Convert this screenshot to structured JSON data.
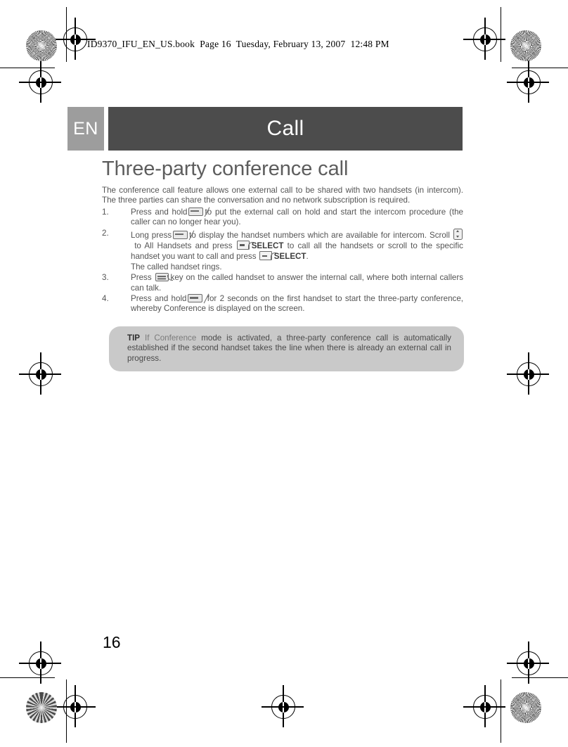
{
  "print_header": {
    "text": "ID9370_IFU_EN_US.book  Page 16  Tuesday, February 13, 2007  12:48 PM"
  },
  "language_tab": {
    "label": "EN"
  },
  "chapter": {
    "title": "Call"
  },
  "section": {
    "title": "Three-party conference call"
  },
  "intro": {
    "text": "The conference call feature allows one external call to be shared with two handsets (in intercom). The three parties can share the conversation and no network subscription is required."
  },
  "steps": [
    {
      "number": "1.",
      "part1": "Press and hold",
      "icon1": "intercom-key-icon",
      "part2": "to put the external call on hold and start the intercom procedure (the caller can no longer hear you)."
    },
    {
      "number": "2.",
      "part1": "Long press",
      "icon1": "intercom-key-icon",
      "part2": "to display the handset numbers which are available for intercom. Scroll",
      "icon2": "scroll-key-icon",
      "part3": "to All Handsets and press",
      "icon3": "soft-key-icon",
      "bold1": "SELECT",
      "part4": "to call all the handsets or scroll to the specific handset you want to call and press",
      "icon4": "soft-key-icon",
      "bold2": "SELECT",
      "part5": ".",
      "part6": "The called handset rings."
    },
    {
      "number": "3.",
      "part1": "Press",
      "icon1": "talk-key-icon",
      "part2": "key on the called handset to answer the internal call, where both internal callers can talk."
    },
    {
      "number": "4.",
      "part1": "Press and hold",
      "icon1": "intercom-key-icon",
      "part2": "for 2 seconds on the first handset to start the three-party conference, whereby Conference is displayed on the screen."
    }
  ],
  "tip": {
    "label": "TIP",
    "emphasis": "If Conference",
    "text": " mode is activated, a three-party conference call is automatically established if the second handset takes the line when there is already an external call in progress."
  },
  "footer": {
    "page_number": "16"
  },
  "colors": {
    "chapter_bar": "#4c4c4c",
    "language_tab": "#9d9d9d",
    "tip_background": "#c9c9c9",
    "body_text": "#545454",
    "section_title": "#5d5d5d"
  }
}
